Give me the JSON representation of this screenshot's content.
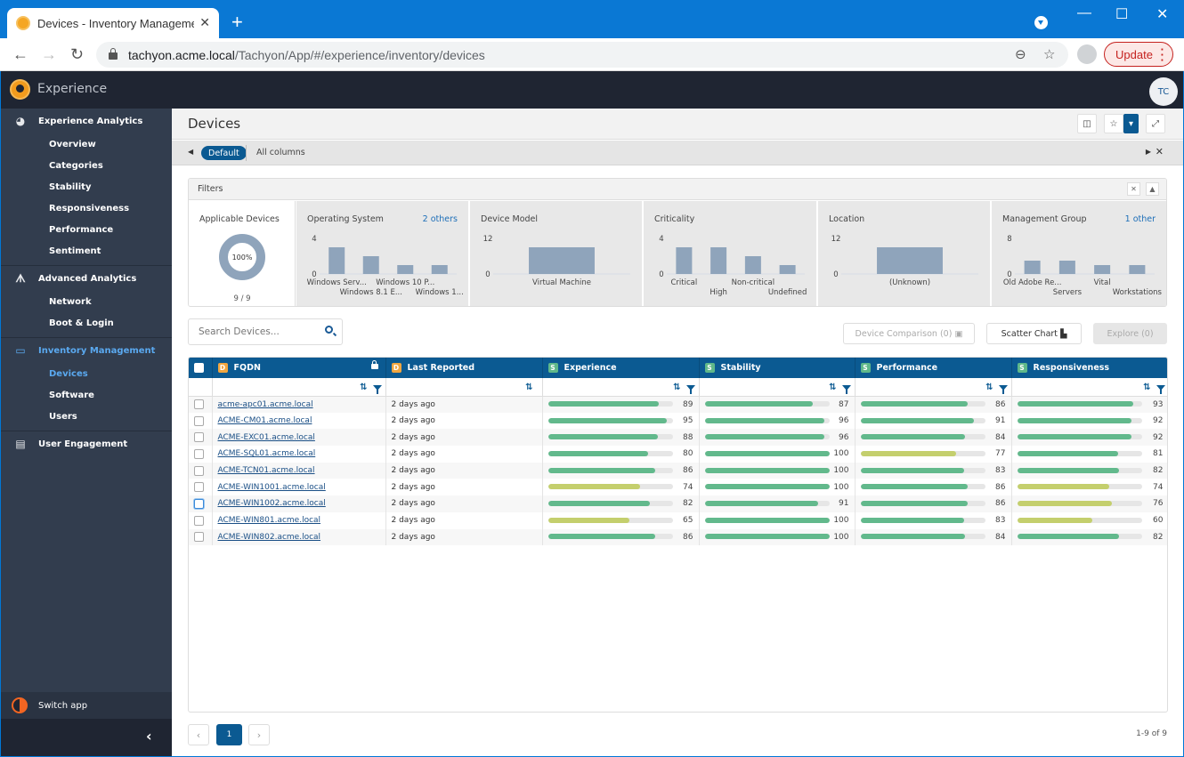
{
  "browser": {
    "tab_title": "Devices - Inventory Management",
    "new_tab": "+",
    "url_host": "tachyon.acme.local",
    "url_path": "/Tachyon/App/#/experience/inventory/devices",
    "update_label": "Update",
    "minimize": "—",
    "maximize": "☐",
    "close": "✕"
  },
  "app": {
    "name": "Experience",
    "user_initials": "TC"
  },
  "sidebar": {
    "groups": [
      {
        "label": "Experience Analytics",
        "icon": "dashboard-icon",
        "items": [
          "Overview",
          "Categories",
          "Stability",
          "Responsiveness",
          "Performance",
          "Sentiment"
        ]
      },
      {
        "label": "Advanced Analytics",
        "icon": "binoculars-icon",
        "items": [
          "Network",
          "Boot & Login"
        ]
      },
      {
        "label": "Inventory Management",
        "icon": "monitor-icon",
        "active": true,
        "items": [
          "Devices",
          "Software",
          "Users"
        ],
        "active_item": "Devices"
      },
      {
        "label": "User Engagement",
        "icon": "clipboard-icon",
        "items": []
      }
    ],
    "switch_app": "Switch app"
  },
  "page": {
    "title": "Devices",
    "views": {
      "selected": "Default",
      "other": "All columns"
    }
  },
  "filters": {
    "title": "Filters",
    "applicable": {
      "title": "Applicable Devices",
      "percent": "100%",
      "count": "9 / 9"
    },
    "panels": [
      {
        "title": "Operating System",
        "more": "2 others",
        "ymax": 4,
        "labels": [
          "Windows Serv...",
          "Windows 8.1 E...",
          "Windows 10 P...",
          "Windows 1..."
        ],
        "values": [
          3,
          2,
          1,
          1
        ]
      },
      {
        "title": "Device Model",
        "more": "",
        "ymax": 12,
        "labels": [
          "Virtual Machine"
        ],
        "values": [
          9
        ]
      },
      {
        "title": "Criticality",
        "more": "",
        "ymax": 4,
        "labels": [
          "Critical",
          "High",
          "Non-critical",
          "Undefined"
        ],
        "values": [
          3,
          3,
          2,
          1
        ]
      },
      {
        "title": "Location",
        "more": "",
        "ymax": 12,
        "labels": [
          "(Unknown)"
        ],
        "values": [
          9
        ]
      },
      {
        "title": "Management Group",
        "more": "1 other",
        "ymax": 8,
        "labels": [
          "Old Adobe Re...",
          "Servers",
          "Vital",
          "Workstations"
        ],
        "values": [
          3,
          3,
          2,
          2
        ]
      }
    ]
  },
  "toolbar": {
    "search_placeholder": "Search Devices...",
    "device_comparison": "Device Comparison (0)",
    "scatter_chart": "Scatter Chart",
    "explore": "Explore (0)"
  },
  "grid": {
    "columns": [
      {
        "label": "FQDN",
        "tag": "D"
      },
      {
        "label": "Last Reported",
        "tag": "D"
      },
      {
        "label": "Experience",
        "tag": "S"
      },
      {
        "label": "Stability",
        "tag": "S"
      },
      {
        "label": "Performance",
        "tag": "S"
      },
      {
        "label": "Responsiveness",
        "tag": "S"
      }
    ],
    "rows": [
      {
        "fqdn": "acme-apc01.acme.local",
        "last": "2 days ago",
        "exp": 89,
        "stab": 87,
        "perf": 86,
        "resp": 93
      },
      {
        "fqdn": "ACME-CM01.acme.local",
        "last": "2 days ago",
        "exp": 95,
        "stab": 96,
        "perf": 91,
        "resp": 92
      },
      {
        "fqdn": "ACME-EXC01.acme.local",
        "last": "2 days ago",
        "exp": 88,
        "stab": 96,
        "perf": 84,
        "resp": 92
      },
      {
        "fqdn": "ACME-SQL01.acme.local",
        "last": "2 days ago",
        "exp": 80,
        "stab": 100,
        "perf": 77,
        "resp": 81
      },
      {
        "fqdn": "ACME-TCN01.acme.local",
        "last": "2 days ago",
        "exp": 86,
        "stab": 100,
        "perf": 83,
        "resp": 82
      },
      {
        "fqdn": "ACME-WIN1001.acme.local",
        "last": "2 days ago",
        "exp": 74,
        "stab": 100,
        "perf": 86,
        "resp": 74
      },
      {
        "fqdn": "ACME-WIN1002.acme.local",
        "last": "2 days ago",
        "exp": 82,
        "stab": 91,
        "perf": 86,
        "resp": 76
      },
      {
        "fqdn": "ACME-WIN801.acme.local",
        "last": "2 days ago",
        "exp": 65,
        "stab": 100,
        "perf": 83,
        "resp": 60
      },
      {
        "fqdn": "ACME-WIN802.acme.local",
        "last": "2 days ago",
        "exp": 86,
        "stab": 100,
        "perf": 84,
        "resp": 82
      }
    ],
    "colors": {
      "good": "#62b98c",
      "warn": "#c4cf6d",
      "track": "#e6e6e6",
      "bar_chart": "#8fa4bb"
    },
    "warn_threshold": 80
  },
  "pagination": {
    "prev": "‹",
    "current": "1",
    "next": "›",
    "summary": "1-9 of 9"
  }
}
